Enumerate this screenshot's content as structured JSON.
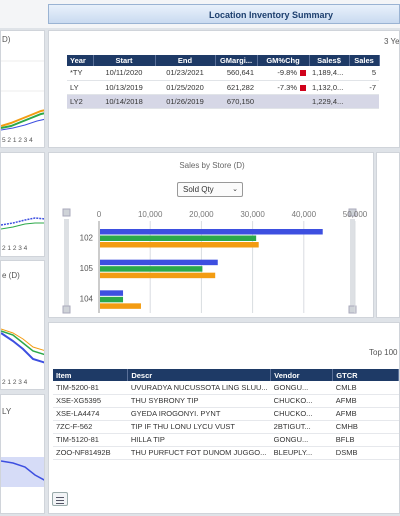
{
  "header": {
    "title": "Location Inventory Summary"
  },
  "side_panels": [
    {
      "title": "D)",
      "axis": "5 2 1 2 3 4"
    },
    {
      "title": "",
      "axis": "2 1 2 3 4"
    },
    {
      "title": "e (D)",
      "axis": "2 1 2 3 4"
    },
    {
      "title": "LY",
      "axis": ""
    }
  ],
  "summary": {
    "years_label": "3 Ye",
    "columns": [
      "Year",
      "Start",
      "End",
      "GMargi...",
      "GM%Chg",
      "Sales$",
      "Sales"
    ],
    "rows": [
      {
        "year": "*TY",
        "start": "10/11/2020",
        "end": "01/23/2021",
        "gmargin": "560,641",
        "gmchg": "-9.8%",
        "flag": true,
        "sales": "1,189,4...",
        "sales2": "5"
      },
      {
        "year": "LY",
        "start": "10/13/2019",
        "end": "01/25/2020",
        "gmargin": "621,282",
        "gmchg": "-7.3%",
        "flag": true,
        "sales": "1,132,0...",
        "sales2": "-7"
      },
      {
        "year": "LY2",
        "start": "10/14/2018",
        "end": "01/26/2019",
        "gmargin": "670,150",
        "gmchg": "",
        "flag": false,
        "sales": "1,229,4...",
        "sales2": ""
      }
    ]
  },
  "chart_data": {
    "type": "bar",
    "title": "Sales by Store (D)",
    "selector": "Sold Qty",
    "x_ticks": [
      "0",
      "10,000",
      "20,000",
      "30,000",
      "40,000",
      "50,000"
    ],
    "xlim": [
      0,
      50000
    ],
    "categories": [
      "102",
      "105",
      "104"
    ],
    "series": [
      {
        "color": "#3d4fe0",
        "values": [
          43500,
          23000,
          4500
        ]
      },
      {
        "color": "#2ca84a",
        "values": [
          30500,
          20000,
          4500
        ]
      },
      {
        "color": "#f39c12",
        "values": [
          31000,
          22500,
          8000
        ]
      }
    ]
  },
  "items": {
    "top_label": "Top 100",
    "columns": [
      "Item",
      "Descr",
      "Vendor",
      "GTCR"
    ],
    "rows": [
      [
        "TIM-5200-81",
        "UVURADYA NUCUSSOTA LING SLUU...",
        "GONGU...",
        "CMLB"
      ],
      [
        "XSE-XG5395",
        "THU SYBRONY TIP",
        "CHUCKO...",
        "AFMB"
      ],
      [
        "XSE-LA4474",
        "GYEDA IROGONYI. PYNT",
        "CHUCKO...",
        "AFMB"
      ],
      [
        "7ZC-F-562",
        "TIP IF THU LONU LYCU VUST",
        "2BTIGUT...",
        "CMHB"
      ],
      [
        "TIM-5120-81",
        "HILLA TIP",
        "GONGU...",
        "BFLB"
      ],
      [
        "ZOO-NF81492B",
        "THU PURFUCT FOT DUNOM JUGGO...",
        "BLEUPLY...",
        "DSMB"
      ]
    ]
  }
}
